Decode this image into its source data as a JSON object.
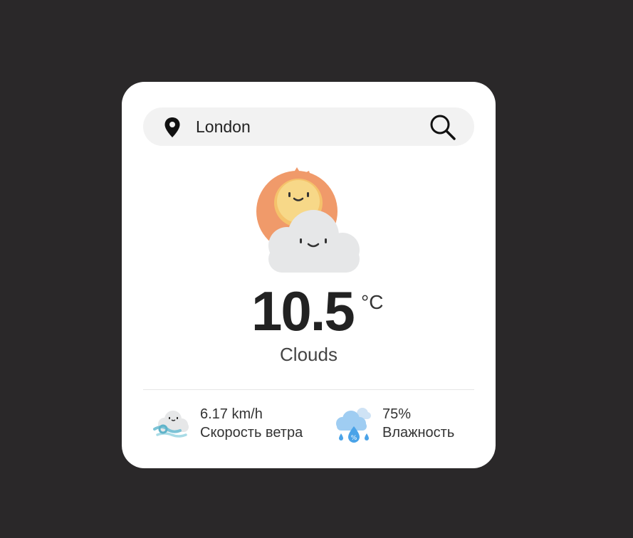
{
  "search": {
    "value": "London",
    "pin_icon": "location-pin-icon",
    "search_icon": "search-icon"
  },
  "weather": {
    "icon": "sun-behind-cloud-icon",
    "temperature": "10.5",
    "unit": "°C",
    "condition": "Clouds"
  },
  "stats": {
    "wind": {
      "icon": "wind-cloud-icon",
      "value": "6.17 km/h",
      "label": "Скорость ветра"
    },
    "humidity": {
      "icon": "humidity-cloud-icon",
      "value": "75%",
      "label": "Влажность"
    }
  },
  "colors": {
    "background": "#2a2829",
    "card": "#ffffff",
    "search_bg": "#f2f2f2",
    "sun": "#f6c96a",
    "sun_rays": "#f09a6a",
    "cloud": "#e8e9ea"
  }
}
